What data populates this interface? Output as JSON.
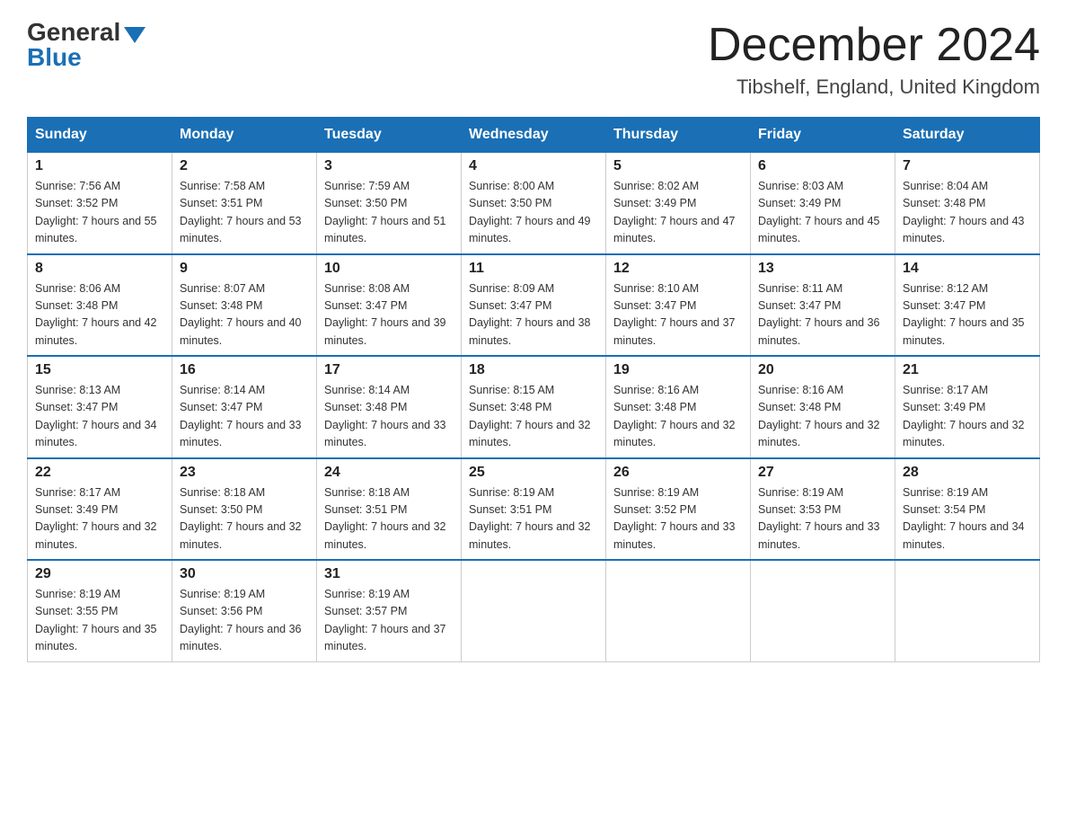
{
  "header": {
    "logo_general": "General",
    "logo_blue": "Blue",
    "month_title": "December 2024",
    "subtitle": "Tibshelf, England, United Kingdom"
  },
  "days_of_week": [
    "Sunday",
    "Monday",
    "Tuesday",
    "Wednesday",
    "Thursday",
    "Friday",
    "Saturday"
  ],
  "weeks": [
    [
      {
        "day": "1",
        "sunrise": "7:56 AM",
        "sunset": "3:52 PM",
        "daylight": "7 hours and 55 minutes."
      },
      {
        "day": "2",
        "sunrise": "7:58 AM",
        "sunset": "3:51 PM",
        "daylight": "7 hours and 53 minutes."
      },
      {
        "day": "3",
        "sunrise": "7:59 AM",
        "sunset": "3:50 PM",
        "daylight": "7 hours and 51 minutes."
      },
      {
        "day": "4",
        "sunrise": "8:00 AM",
        "sunset": "3:50 PM",
        "daylight": "7 hours and 49 minutes."
      },
      {
        "day": "5",
        "sunrise": "8:02 AM",
        "sunset": "3:49 PM",
        "daylight": "7 hours and 47 minutes."
      },
      {
        "day": "6",
        "sunrise": "8:03 AM",
        "sunset": "3:49 PM",
        "daylight": "7 hours and 45 minutes."
      },
      {
        "day": "7",
        "sunrise": "8:04 AM",
        "sunset": "3:48 PM",
        "daylight": "7 hours and 43 minutes."
      }
    ],
    [
      {
        "day": "8",
        "sunrise": "8:06 AM",
        "sunset": "3:48 PM",
        "daylight": "7 hours and 42 minutes."
      },
      {
        "day": "9",
        "sunrise": "8:07 AM",
        "sunset": "3:48 PM",
        "daylight": "7 hours and 40 minutes."
      },
      {
        "day": "10",
        "sunrise": "8:08 AM",
        "sunset": "3:47 PM",
        "daylight": "7 hours and 39 minutes."
      },
      {
        "day": "11",
        "sunrise": "8:09 AM",
        "sunset": "3:47 PM",
        "daylight": "7 hours and 38 minutes."
      },
      {
        "day": "12",
        "sunrise": "8:10 AM",
        "sunset": "3:47 PM",
        "daylight": "7 hours and 37 minutes."
      },
      {
        "day": "13",
        "sunrise": "8:11 AM",
        "sunset": "3:47 PM",
        "daylight": "7 hours and 36 minutes."
      },
      {
        "day": "14",
        "sunrise": "8:12 AM",
        "sunset": "3:47 PM",
        "daylight": "7 hours and 35 minutes."
      }
    ],
    [
      {
        "day": "15",
        "sunrise": "8:13 AM",
        "sunset": "3:47 PM",
        "daylight": "7 hours and 34 minutes."
      },
      {
        "day": "16",
        "sunrise": "8:14 AM",
        "sunset": "3:47 PM",
        "daylight": "7 hours and 33 minutes."
      },
      {
        "day": "17",
        "sunrise": "8:14 AM",
        "sunset": "3:48 PM",
        "daylight": "7 hours and 33 minutes."
      },
      {
        "day": "18",
        "sunrise": "8:15 AM",
        "sunset": "3:48 PM",
        "daylight": "7 hours and 32 minutes."
      },
      {
        "day": "19",
        "sunrise": "8:16 AM",
        "sunset": "3:48 PM",
        "daylight": "7 hours and 32 minutes."
      },
      {
        "day": "20",
        "sunrise": "8:16 AM",
        "sunset": "3:48 PM",
        "daylight": "7 hours and 32 minutes."
      },
      {
        "day": "21",
        "sunrise": "8:17 AM",
        "sunset": "3:49 PM",
        "daylight": "7 hours and 32 minutes."
      }
    ],
    [
      {
        "day": "22",
        "sunrise": "8:17 AM",
        "sunset": "3:49 PM",
        "daylight": "7 hours and 32 minutes."
      },
      {
        "day": "23",
        "sunrise": "8:18 AM",
        "sunset": "3:50 PM",
        "daylight": "7 hours and 32 minutes."
      },
      {
        "day": "24",
        "sunrise": "8:18 AM",
        "sunset": "3:51 PM",
        "daylight": "7 hours and 32 minutes."
      },
      {
        "day": "25",
        "sunrise": "8:19 AM",
        "sunset": "3:51 PM",
        "daylight": "7 hours and 32 minutes."
      },
      {
        "day": "26",
        "sunrise": "8:19 AM",
        "sunset": "3:52 PM",
        "daylight": "7 hours and 33 minutes."
      },
      {
        "day": "27",
        "sunrise": "8:19 AM",
        "sunset": "3:53 PM",
        "daylight": "7 hours and 33 minutes."
      },
      {
        "day": "28",
        "sunrise": "8:19 AM",
        "sunset": "3:54 PM",
        "daylight": "7 hours and 34 minutes."
      }
    ],
    [
      {
        "day": "29",
        "sunrise": "8:19 AM",
        "sunset": "3:55 PM",
        "daylight": "7 hours and 35 minutes."
      },
      {
        "day": "30",
        "sunrise": "8:19 AM",
        "sunset": "3:56 PM",
        "daylight": "7 hours and 36 minutes."
      },
      {
        "day": "31",
        "sunrise": "8:19 AM",
        "sunset": "3:57 PM",
        "daylight": "7 hours and 37 minutes."
      },
      null,
      null,
      null,
      null
    ]
  ]
}
